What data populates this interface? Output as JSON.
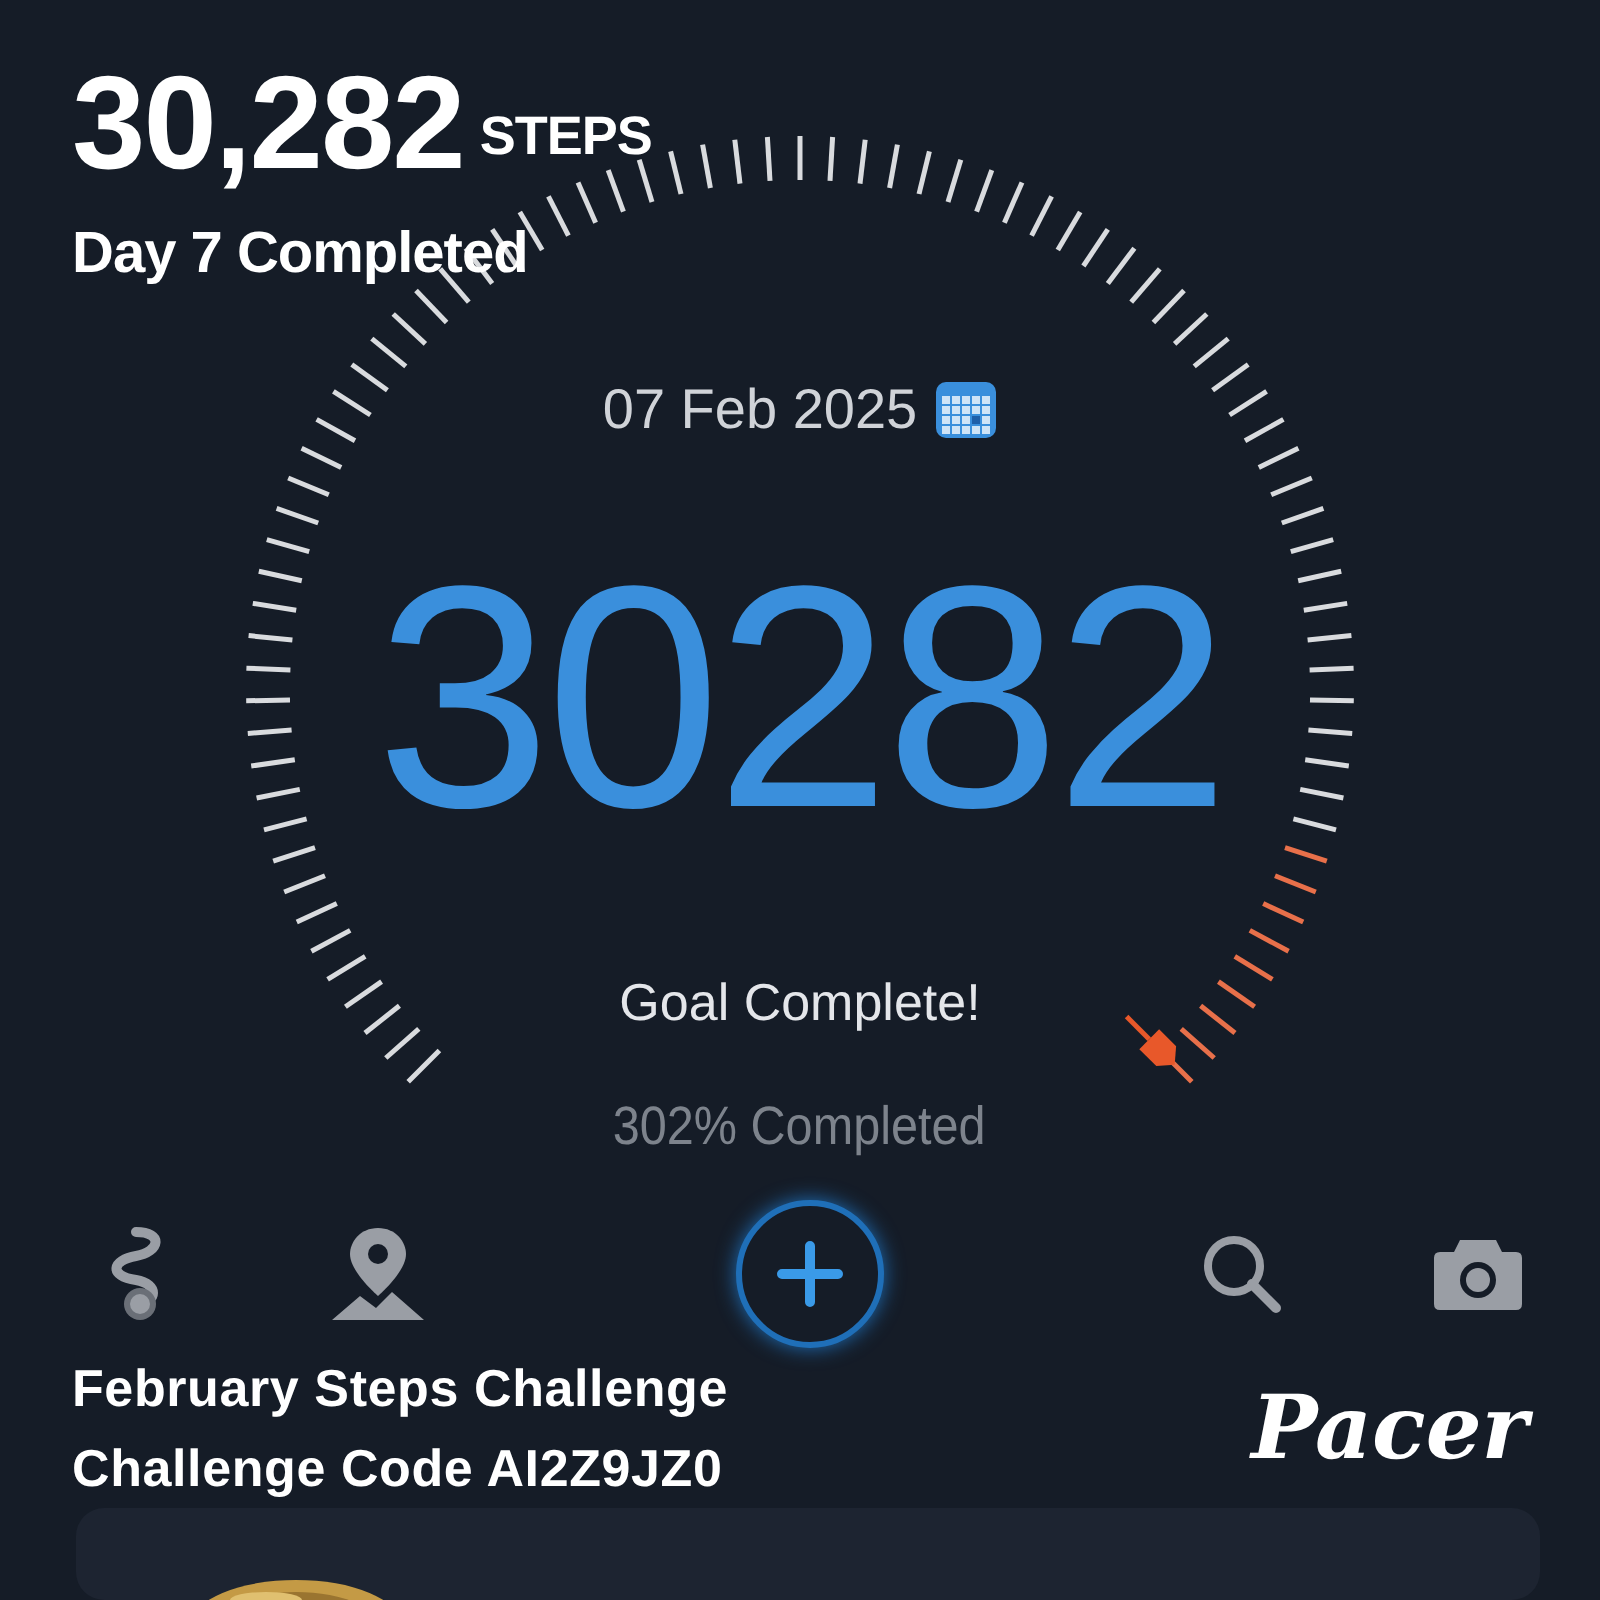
{
  "header": {
    "steps": "30,282",
    "unit": "STEPS",
    "day_status": "Day 7 Completed"
  },
  "date": "07 Feb 2025",
  "step_count": "30282",
  "goal_status": "Goal Complete!",
  "percent": "302% Completed",
  "toolbar": [
    {
      "kind": "route"
    },
    {
      "kind": "map"
    },
    {
      "kind": "add"
    },
    {
      "kind": "search"
    },
    {
      "kind": "camera"
    }
  ],
  "challenge": {
    "title": "February Steps Challenge",
    "code": "Challenge Code AI2Z9JZ0"
  },
  "brand": "Pacer"
}
